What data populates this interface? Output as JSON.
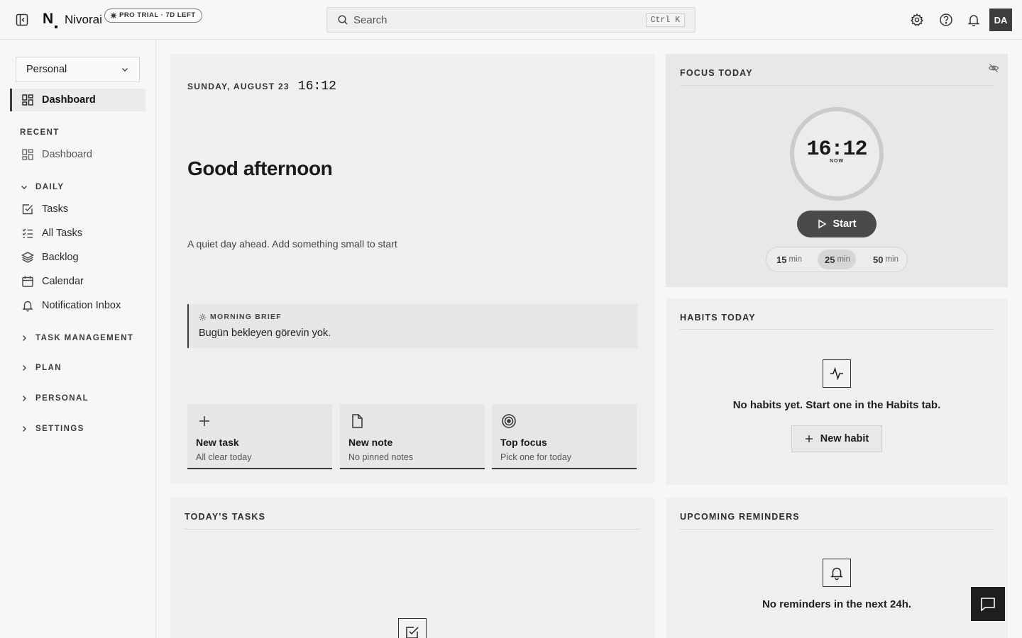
{
  "app": {
    "name": "Nivorai",
    "logo_letter": "N",
    "trial_badge": "PRO TRIAL · 7D LEFT"
  },
  "search": {
    "placeholder": "Search",
    "shortcut": "Ctrl K"
  },
  "header_icons": [
    "settings-icon",
    "help-icon",
    "bell-icon"
  ],
  "user": {
    "initials": "DA"
  },
  "sidebar": {
    "workspace": "Personal",
    "active_item": "Dashboard",
    "recent_label": "RECENT",
    "recent_items": [
      {
        "label": "Dashboard",
        "icon": "grid-icon"
      }
    ],
    "daily_label": "DAILY",
    "daily_items": [
      {
        "label": "Tasks",
        "icon": "checkbox-icon"
      },
      {
        "label": "All Tasks",
        "icon": "list-check-icon"
      },
      {
        "label": "Backlog",
        "icon": "layers-icon"
      },
      {
        "label": "Calendar",
        "icon": "calendar-icon"
      },
      {
        "label": "Notification Inbox",
        "icon": "bell-icon"
      }
    ],
    "collapsed_sections": [
      "TASK MANAGEMENT",
      "PLAN",
      "PERSONAL",
      "SETTINGS"
    ]
  },
  "hero": {
    "date": "SUNDAY, AUGUST 23",
    "time": "16:12",
    "greeting": "Good afternoon",
    "subtitle": "A quiet day ahead. Add something small to start",
    "brief_label": "MORNING BRIEF",
    "brief_text": "Bugün bekleyen görevin yok.",
    "quick_actions": [
      {
        "title": "New task",
        "subtitle": "All clear today",
        "icon": "plus-icon"
      },
      {
        "title": "New note",
        "subtitle": "No pinned notes",
        "icon": "note-icon"
      },
      {
        "title": "Top focus",
        "subtitle": "Pick one for today",
        "icon": "target-icon"
      }
    ]
  },
  "focus": {
    "title": "FOCUS TODAY",
    "clock": "16:12",
    "clock_sub": "NOW",
    "start_label": "Start",
    "durations": [
      {
        "value": "15",
        "unit": "min"
      },
      {
        "value": "25",
        "unit": "min"
      },
      {
        "value": "50",
        "unit": "min"
      }
    ],
    "selected_duration": "25"
  },
  "habits": {
    "title": "HABITS TODAY",
    "empty_text": "No habits yet. Start one in the Habits tab.",
    "new_button": "New habit"
  },
  "tasks": {
    "title": "TODAY'S TASKS"
  },
  "reminders": {
    "title": "UPCOMING REMINDERS",
    "empty_text": "No reminders in the next 24h."
  },
  "colors": {
    "background": "#f7f7f7",
    "card": "#efefef",
    "accent_dark": "#3a3a3a",
    "start_button": "#4a4a4c"
  }
}
